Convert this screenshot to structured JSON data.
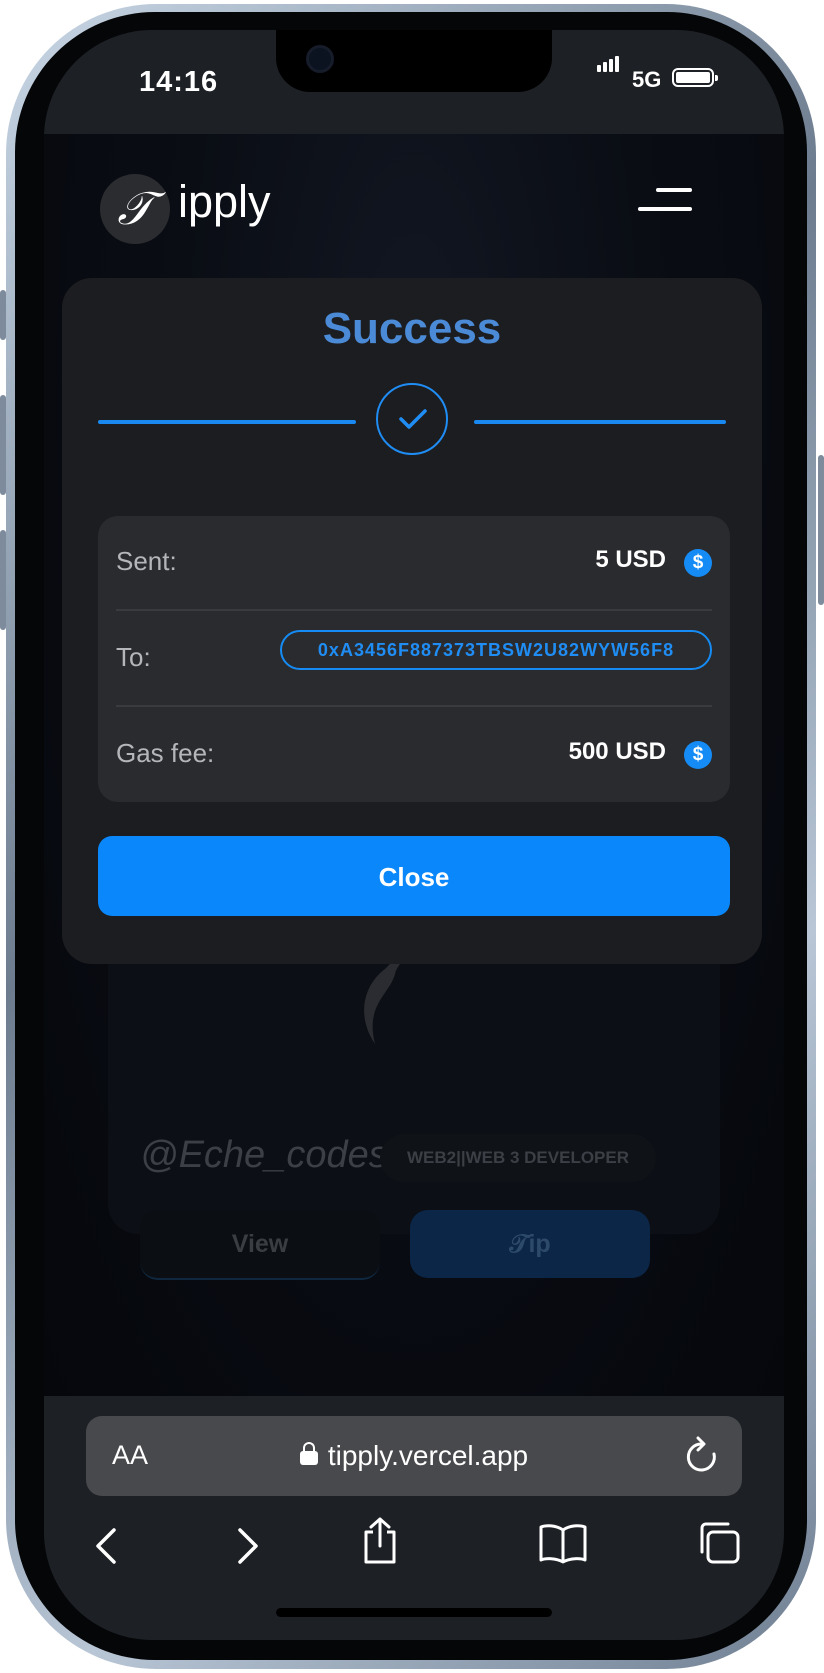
{
  "status_bar": {
    "time": "14:16",
    "network": "5G"
  },
  "app": {
    "logo_letter": "𝒯",
    "brand_text": "ipply"
  },
  "modal": {
    "title": "Success",
    "rows": [
      {
        "label": "Sent:",
        "value": "5 USD",
        "currency_icon": "$"
      },
      {
        "label": "To:",
        "address": "0xA3456F887373TBSW2U82WYW56F8"
      },
      {
        "label": "Gas fee:",
        "value": "500 USD",
        "currency_icon": "$"
      }
    ],
    "close_label": "Close",
    "accent": "#0a87fa",
    "title_color": "#4a8ad6"
  },
  "background_profile": {
    "handle": "@Eche_codes",
    "badge": "WEB2||WEB 3 DEVELOPER",
    "view_label": "View",
    "tip_label": "𝒯ip"
  },
  "browser": {
    "aa_label": "AA",
    "url": "tipply.vercel.app"
  }
}
